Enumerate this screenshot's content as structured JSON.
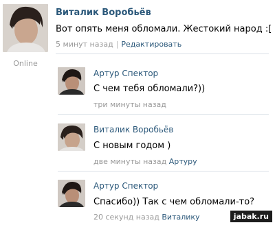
{
  "post": {
    "author": "Виталик Воробьёв",
    "text": "Вот опять меня обломали. Жестокий народ :[",
    "time": "5 минут назад",
    "separator": "|",
    "edit_label": "Редактировать",
    "status": "Online"
  },
  "replies": [
    {
      "author": "Артур Спектор",
      "text": "С чем тебя обломали?))",
      "time": "три минуты назад",
      "to": ""
    },
    {
      "author": "Виталик Воробьёв",
      "text": "С новым годом )",
      "time": "две минуты назад",
      "to": "Артуру"
    },
    {
      "author": "Артур Спектор",
      "text": "Спасибо)) Так с чем обломали-то?",
      "time": "20 секунд назад",
      "to": "Виталику"
    }
  ],
  "watermark": "jabak.ru",
  "colors": {
    "link": "#2b587a",
    "meta": "#999999",
    "divider": "#dae1e8"
  }
}
